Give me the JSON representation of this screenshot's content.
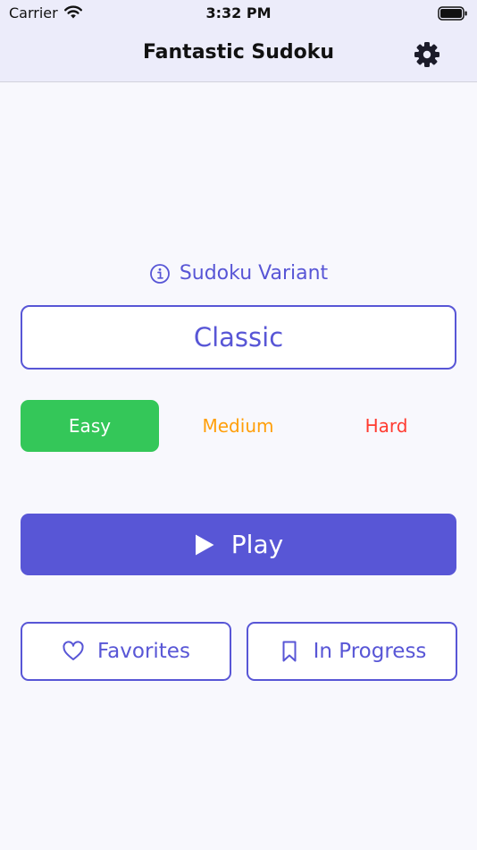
{
  "status_bar": {
    "carrier": "Carrier",
    "time": "3:32 PM"
  },
  "nav": {
    "title": "Fantastic Sudoku"
  },
  "variant": {
    "label": "Sudoku Variant",
    "selected": "Classic"
  },
  "difficulty": {
    "options": [
      "Easy",
      "Medium",
      "Hard"
    ],
    "selected": "Easy"
  },
  "play": {
    "label": "Play"
  },
  "actions": {
    "favorites": "Favorites",
    "in_progress": "In Progress"
  },
  "colors": {
    "accent": "#5856d6",
    "easy": "#34c759",
    "medium": "#ff9f0a",
    "hard": "#ff3b30",
    "header_bg": "#ececfa"
  },
  "icons": {
    "settings": "gear-icon",
    "info": "info-icon",
    "play": "play-icon",
    "favorites": "heart-icon",
    "in_progress": "bookmark-icon"
  }
}
